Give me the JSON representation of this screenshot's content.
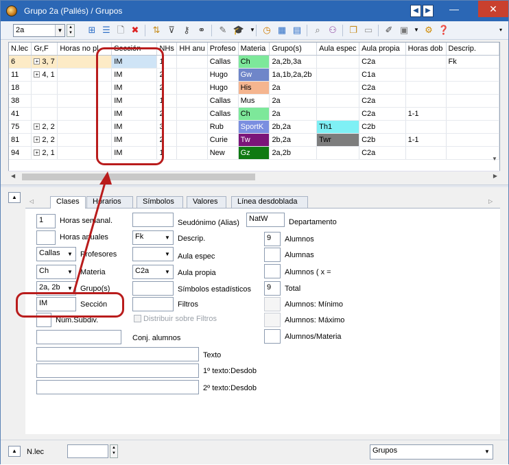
{
  "window": {
    "title": "Grupo 2a (Pallés) / Grupos"
  },
  "toolbar": {
    "group_value": "2a"
  },
  "grid": {
    "columns": [
      "N.lec",
      "Gr,F",
      "Horas no pl.",
      "Sección",
      "NHs",
      "HH anu",
      "Profeso",
      "Materia",
      "Grupo(s)",
      "Aula espec",
      "Aula propia",
      "Horas dob",
      "Descrip."
    ],
    "rows": [
      {
        "nlec": "6",
        "gr": "3, 7",
        "horas": "",
        "seccion": "IM",
        "nhs": "1",
        "hh": "",
        "prof": "Callas",
        "materia": "Ch",
        "grupos": "2a,2b,3a",
        "aula_esp": "",
        "aula_prop": "C2a",
        "dob": "",
        "descrip": "Fk"
      },
      {
        "nlec": "11",
        "gr": "4, 1",
        "horas": "",
        "seccion": "IM",
        "nhs": "2",
        "hh": "",
        "prof": "Hugo",
        "materia": "Gw",
        "grupos": "1a,1b,2a,2b",
        "aula_esp": "",
        "aula_prop": "C1a",
        "dob": "",
        "descrip": ""
      },
      {
        "nlec": "18",
        "gr": "",
        "horas": "",
        "seccion": "IM",
        "nhs": "2",
        "hh": "",
        "prof": "Hugo",
        "materia": "His",
        "grupos": "2a",
        "aula_esp": "",
        "aula_prop": "C2a",
        "dob": "",
        "descrip": ""
      },
      {
        "nlec": "38",
        "gr": "",
        "horas": "",
        "seccion": "IM",
        "nhs": "1",
        "hh": "",
        "prof": "Callas",
        "materia": "Mus",
        "grupos": "2a",
        "aula_esp": "",
        "aula_prop": "C2a",
        "dob": "",
        "descrip": ""
      },
      {
        "nlec": "41",
        "gr": "",
        "horas": "",
        "seccion": "IM",
        "nhs": "2",
        "hh": "",
        "prof": "Callas",
        "materia": "Ch",
        "grupos": "2a",
        "aula_esp": "",
        "aula_prop": "C2a",
        "dob": "1-1",
        "descrip": ""
      },
      {
        "nlec": "75",
        "gr": "2, 2",
        "horas": "",
        "seccion": "IM",
        "nhs": "3",
        "hh": "",
        "prof": "Rub",
        "materia": "SportK",
        "grupos": "2b,2a",
        "aula_esp": "Th1",
        "aula_prop": "C2b",
        "dob": "",
        "descrip": ""
      },
      {
        "nlec": "81",
        "gr": "2, 2",
        "horas": "",
        "seccion": "IM",
        "nhs": "2",
        "hh": "",
        "prof": "Curie",
        "materia": "Tw",
        "grupos": "2b,2a",
        "aula_esp": "Twr",
        "aula_prop": "C2b",
        "dob": "1-1",
        "descrip": ""
      },
      {
        "nlec": "94",
        "gr": "2, 1",
        "horas": "",
        "seccion": "IM",
        "nhs": "1",
        "hh": "",
        "prof": "New",
        "materia": "Gz",
        "grupos": "2a,2b",
        "aula_esp": "",
        "aula_prop": "C2a",
        "dob": "",
        "descrip": ""
      }
    ]
  },
  "tabs": [
    "Clases",
    "Horarios",
    "Símbolos",
    "Valores",
    "Línea desdoblada"
  ],
  "form": {
    "horas_semanal_value": "1",
    "horas_semanal_label": "Horas semanal.",
    "horas_anuales_label": "Horas anuales",
    "profesores_value": "Callas",
    "profesores_label": "Profesores",
    "materia_value": "Ch",
    "materia_label": "Materia",
    "grupos_value": "2a, 2b",
    "grupos_label": "Grupo(s)",
    "seccion_value": "IM",
    "seccion_label": "Sección",
    "num_subdiv_label": "Núm.Subdiv.",
    "conj_alumnos_label": "Conj. alumnos",
    "seudonimo_label": "Seudónimo (Alias)",
    "descrip_value": "Fk",
    "descrip_label": "Descrip.",
    "aula_espec_label": "Aula espec",
    "aula_propia_value": "C2a",
    "aula_propia_label": "Aula propia",
    "simbolos_label": "Símbolos estadísticos",
    "filtros_label": "Filtros",
    "distribuir_label": "Distribuir sobre Filtros",
    "departamento_value": "NatW",
    "departamento_label": "Departamento",
    "alumnos_value": "9",
    "alumnos_label": "Alumnos",
    "alumnas_label": "Alumnas",
    "alumnos_x_label": "Alumnos ( x =",
    "total_value": "9",
    "total_label": "Total",
    "alumnos_min_label": "Alumnos: Mínimo",
    "alumnos_max_label": "Alumnos: Máximo",
    "alumnos_materia_label": "Alumnos/Materia",
    "texto_label": "Texto",
    "texto1_label": "1º texto:Desdob",
    "texto2_label": "2º texto:Desdob"
  },
  "bottom": {
    "nlec_label": "N.lec",
    "view_value": "Grupos"
  },
  "colors": {
    "Ch": "#7de89a",
    "Gw": "#6f86c9",
    "His": "#f5b58f",
    "SportK": "#7a8ee0",
    "Tw": "#7b1579",
    "Gz": "#0f7a12",
    "Th1": "#7ff0f5",
    "Twr": "#7d7d7d",
    "callout": "#b91c1c"
  }
}
